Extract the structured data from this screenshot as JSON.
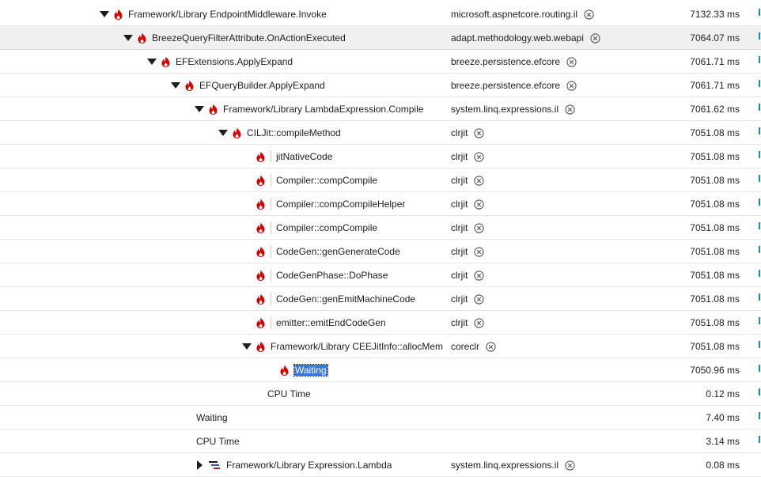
{
  "rows": [
    {
      "depth": 0,
      "toggle": "down",
      "icon": "flame",
      "name": "Framework/Library EndpointMiddleware.Invoke",
      "module": "microsoft.aspnetcore.routing.il",
      "time": "7132.33 ms"
    },
    {
      "depth": 1,
      "toggle": "down",
      "icon": "flame",
      "name": "BreezeQueryFilterAttribute.OnActionExecuted",
      "module": "adapt.methodology.web.webapi",
      "time": "7064.07 ms",
      "selected": true
    },
    {
      "depth": 2,
      "toggle": "down",
      "icon": "flame",
      "name": "EFExtensions.ApplyExpand",
      "module": "breeze.persistence.efcore",
      "time": "7061.71 ms"
    },
    {
      "depth": 3,
      "toggle": "down",
      "icon": "flame",
      "name": "EFQueryBuilder.ApplyExpand",
      "module": "breeze.persistence.efcore",
      "time": "7061.71 ms"
    },
    {
      "depth": 4,
      "toggle": "down",
      "icon": "flame",
      "name": "Framework/Library LambdaExpression.Compile",
      "module": "system.linq.expressions.il",
      "time": "7061.62 ms"
    },
    {
      "depth": 5,
      "toggle": "down",
      "icon": "flame",
      "name": "CILJit::compileMethod",
      "module": "clrjit",
      "time": "7051.08 ms"
    },
    {
      "depth": 6,
      "toggle": "none",
      "icon": "flame",
      "sep": true,
      "name": "jitNativeCode",
      "module": "clrjit",
      "time": "7051.08 ms"
    },
    {
      "depth": 6,
      "toggle": "none",
      "icon": "flame",
      "sep": true,
      "name": "Compiler::compCompile",
      "module": "clrjit",
      "time": "7051.08 ms"
    },
    {
      "depth": 6,
      "toggle": "none",
      "icon": "flame",
      "sep": true,
      "name": "Compiler::compCompileHelper",
      "module": "clrjit",
      "time": "7051.08 ms"
    },
    {
      "depth": 6,
      "toggle": "none",
      "icon": "flame",
      "sep": true,
      "name": "Compiler::compCompile",
      "module": "clrjit",
      "time": "7051.08 ms"
    },
    {
      "depth": 6,
      "toggle": "none",
      "icon": "flame",
      "sep": true,
      "name": "CodeGen::genGenerateCode",
      "module": "clrjit",
      "time": "7051.08 ms"
    },
    {
      "depth": 6,
      "toggle": "none",
      "icon": "flame",
      "sep": true,
      "name": "CodeGenPhase::DoPhase",
      "module": "clrjit",
      "time": "7051.08 ms"
    },
    {
      "depth": 6,
      "toggle": "none",
      "icon": "flame",
      "sep": true,
      "name": "CodeGen::genEmitMachineCode",
      "module": "clrjit",
      "time": "7051.08 ms"
    },
    {
      "depth": 6,
      "toggle": "none",
      "icon": "flame",
      "sep": true,
      "name": "emitter::emitEndCodeGen",
      "module": "clrjit",
      "time": "7051.08 ms"
    },
    {
      "depth": 6,
      "toggle": "down",
      "icon": "flame",
      "name": "Framework/Library CEEJitInfo::allocMem",
      "module": "coreclr",
      "time": "7051.08 ms"
    },
    {
      "depth": 7,
      "toggle": "none",
      "icon": "flame",
      "name": "Waiting",
      "module": "",
      "time": "7050.96 ms",
      "highlight": true
    },
    {
      "depth": 7,
      "toggle": "none",
      "icon": "none",
      "name": "CPU Time",
      "module": "",
      "time": "0.12 ms"
    },
    {
      "depth": 4,
      "toggle": "none",
      "icon": "none",
      "name": "Waiting",
      "module": "",
      "time": "7.40 ms"
    },
    {
      "depth": 4,
      "toggle": "none",
      "icon": "none",
      "name": "CPU Time",
      "module": "",
      "time": "3.14 ms"
    },
    {
      "depth": 4,
      "toggle": "right",
      "icon": "lambda",
      "name": "Framework/Library Expression.Lambda",
      "module": "system.linq.expressions.il",
      "time": "0.08 ms"
    }
  ],
  "colors": {
    "flame": "#d70000",
    "selected_row": "#f0f0f0",
    "highlight": "#3875d7",
    "icon_gray": "#5a5a5a",
    "edge_mark": "#1592a8"
  },
  "icons": {
    "expanded": "triangle-down-icon",
    "collapsed": "triangle-right-icon",
    "hot_path": "flame-icon",
    "module_action": "circle-x-icon",
    "lambda": "expression-lambda-icon"
  }
}
